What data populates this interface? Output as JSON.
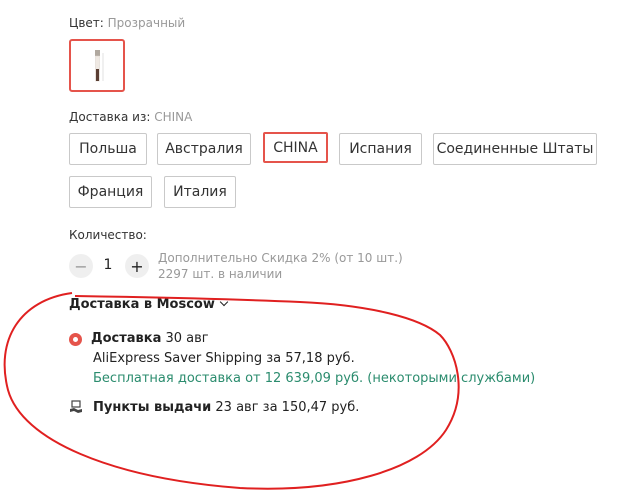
{
  "color": {
    "label": "Цвет:",
    "value": "Прозрачный"
  },
  "ship_from": {
    "label": "Доставка из:",
    "value": "CHINA",
    "options": [
      "Польша",
      "Австралия",
      "CHINA",
      "Испания",
      "Соединенные Штаты",
      "Франция",
      "Италия"
    ]
  },
  "quantity": {
    "label": "Количество:",
    "value": "1",
    "minus": "−",
    "plus": "+",
    "discount_note": "Дополнительно Скидка 2% (от 10 шт.)",
    "stock_note": "2297 шт. в наличии"
  },
  "delivery": {
    "heading": "Доставка в Moscow",
    "courier": {
      "title": "Доставка",
      "date": "30 авг",
      "method": "AliExpress Saver Shipping за 57,18 руб.",
      "free_note": "Бесплатная доставка от 12 639,09 руб. (некоторыми службами)"
    },
    "pickup": {
      "title": "Пункты выдачи",
      "details": "23 авг за 150,47 руб."
    }
  },
  "accent_color": "#e5544b",
  "free_color": "#2b8c6e"
}
